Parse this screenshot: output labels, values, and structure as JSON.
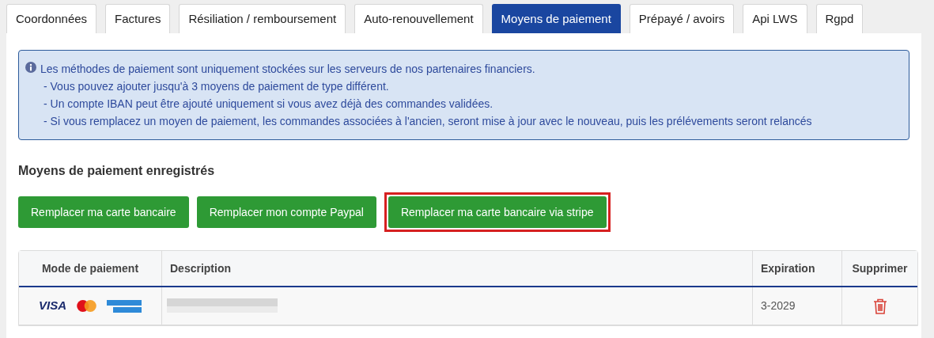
{
  "tabs": [
    {
      "label": "Coordonnées",
      "selected": false
    },
    {
      "label": "Factures",
      "selected": false
    },
    {
      "label": "Résiliation / remboursement",
      "selected": false
    },
    {
      "label": "Auto-renouvellement",
      "selected": false
    },
    {
      "label": "Moyens de paiement",
      "selected": true
    },
    {
      "label": "Prépayé / avoirs",
      "selected": false
    },
    {
      "label": "Api LWS",
      "selected": false
    },
    {
      "label": "Rgpd",
      "selected": false
    }
  ],
  "info": {
    "lines": [
      "Les méthodes de paiement sont uniquement stockées sur les serveurs de nos partenaires financiers.",
      "- Vous pouvez ajouter jusqu'à 3 moyens de paiement de type différent.",
      "- Un compte IBAN peut être ajouté uniquement si vous avez déjà des commandes validées.",
      "- Si vous remplacez un moyen de paiement, les commandes associées à l'ancien, seront mise à jour avec le nouveau, puis les prélévements seront relancés"
    ]
  },
  "section_title": "Moyens de paiement enregistrés",
  "buttons": [
    {
      "label": "Remplacer ma carte bancaire",
      "highlighted": false
    },
    {
      "label": "Remplacer mon compte Paypal",
      "highlighted": false
    },
    {
      "label": "Remplacer ma carte bancaire via stripe",
      "highlighted": true
    }
  ],
  "table": {
    "columns": [
      "Mode de paiement",
      "Description",
      "Expiration",
      "Supprimer"
    ],
    "rows": [
      {
        "visa_logo": "VISA",
        "expiration": "3-2029"
      }
    ]
  }
}
